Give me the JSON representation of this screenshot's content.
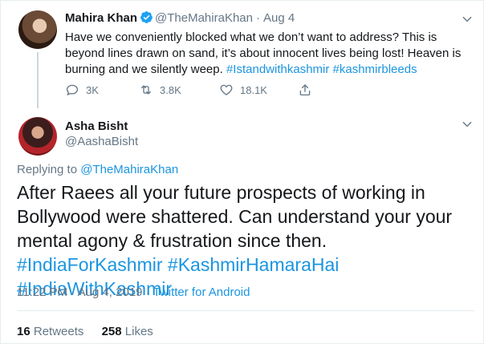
{
  "parent_tweet": {
    "author_name": "Mahira Khan",
    "handle": "@TheMahiraKhan",
    "separator": "·",
    "date": "Aug 4",
    "text_plain": "Have we conveniently blocked what we don’t want to address? This is beyond lines drawn on sand, it’s about innocent lives being lost! Heaven is burning and we silently weep.",
    "hashtags": [
      "#Istandwithkashmir",
      "#kashmirbleeds"
    ],
    "reply_count": "3K",
    "retweet_count": "3.8K",
    "like_count": "18.1K"
  },
  "reply_tweet": {
    "author_name": "Asha Bisht",
    "handle": "@AashaBisht",
    "replying_to_label": "Replying to",
    "replying_to_handle": "@TheMahiraKhan",
    "text_plain": "After Raees all your future prospects of working in Bollywood were shattered. Can understand your your mental agony & frustration since then.",
    "hashtags": [
      "#IndiaForKashmir",
      "#KashmirHamaraHai",
      "#IndiaWithKashmir"
    ],
    "time": "11:22 PM",
    "separator": "·",
    "date": "Aug 4, 2019",
    "client": "Twitter for Android",
    "retweets_count": "16",
    "retweets_label": "Retweets",
    "likes_count": "258",
    "likes_label": "Likes"
  },
  "colors": {
    "accent": "#1b95e0",
    "secondary_text": "#657786",
    "primary_text": "#14171a",
    "border": "#e6ecf0"
  },
  "icons": {
    "verified": "verified-badge-icon",
    "caret": "chevron-down-icon",
    "reply": "reply-icon",
    "retweet": "retweet-icon",
    "like": "heart-icon",
    "share": "share-icon"
  }
}
